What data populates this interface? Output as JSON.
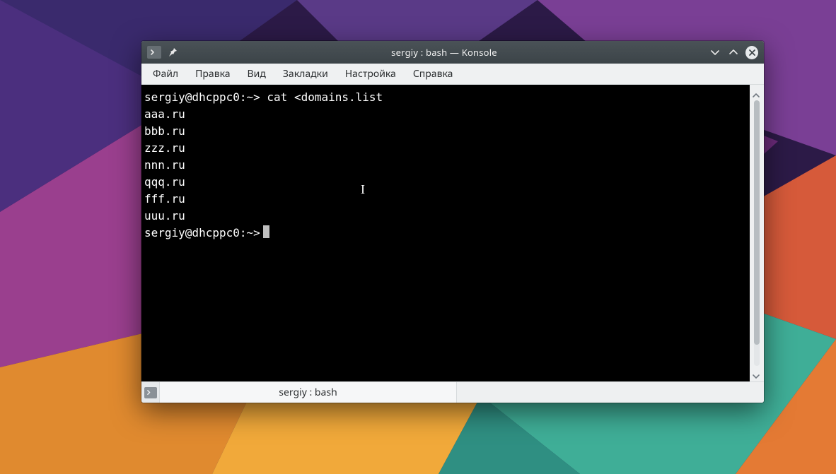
{
  "window": {
    "title": "sergiy : bash — Konsole"
  },
  "menubar": {
    "items": [
      "Файл",
      "Правка",
      "Вид",
      "Закладки",
      "Настройка",
      "Справка"
    ]
  },
  "terminal": {
    "prompt": "sergiy@dhcppc0:~>",
    "command": "cat <domains.list",
    "output": [
      "aaa.ru",
      "bbb.ru",
      "zzz.ru",
      "nnn.ru",
      "qqq.ru",
      "fff.ru",
      "uuu.ru"
    ]
  },
  "tabbar": {
    "tab_label": "sergiy : bash"
  }
}
